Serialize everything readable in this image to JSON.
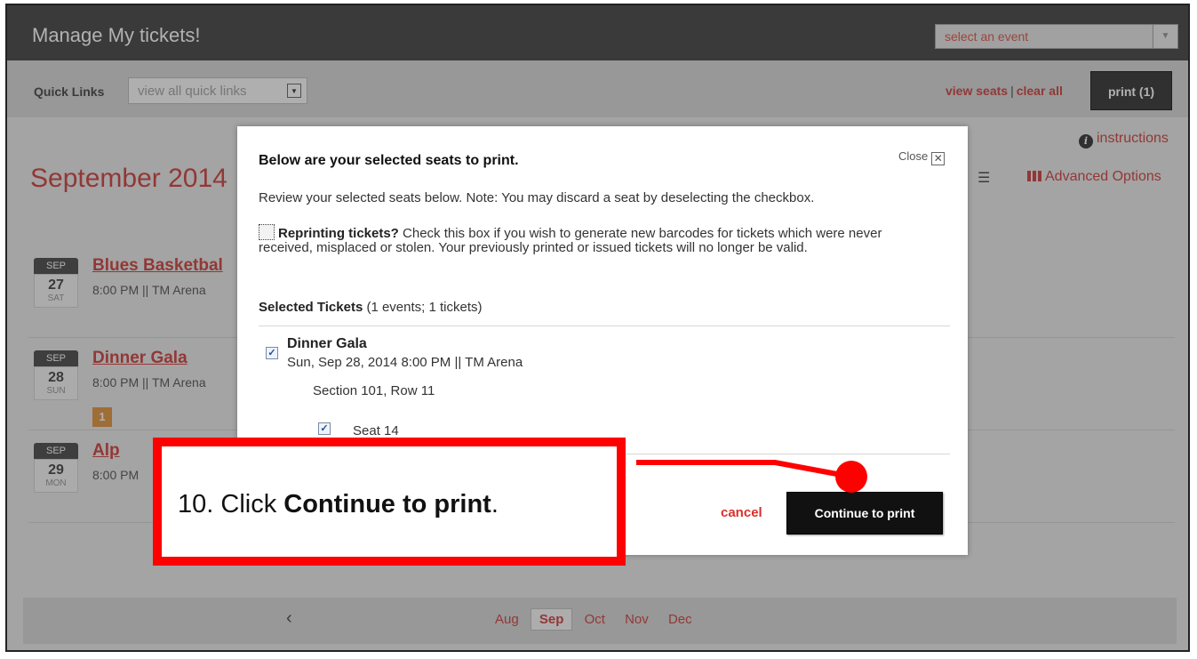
{
  "app": {
    "title": "Manage My tickets!",
    "event_select": {
      "value": "select an event"
    }
  },
  "quicklinks": {
    "label": "Quick Links",
    "select_value": "view all quick links"
  },
  "top_actions": {
    "view_seats": "view seats",
    "separator": "|",
    "clear_all": "clear all",
    "print_button": "print (1)"
  },
  "toolbar": {
    "instructions": "instructions",
    "advanced_options": "Advanced Options"
  },
  "calendar": {
    "month_title": "September 2014",
    "events": [
      {
        "month": "SEP",
        "day": "27",
        "weekday": "SAT",
        "name": "Blues Basketbal",
        "meta": "8:00 PM || TM Arena",
        "badge": ""
      },
      {
        "month": "SEP",
        "day": "28",
        "weekday": "SUN",
        "name": "Dinner Gala",
        "meta": "8:00 PM || TM Arena",
        "badge": "1"
      },
      {
        "month": "SEP",
        "day": "29",
        "weekday": "MON",
        "name": "Alp",
        "meta": "8:00 PM",
        "badge": ""
      }
    ],
    "nav": {
      "prev_icon": "chevron-left",
      "months": [
        "Aug",
        "Sep",
        "Oct",
        "Nov",
        "Dec"
      ],
      "active": "Sep"
    }
  },
  "modal": {
    "title": "Below are your selected seats to print.",
    "close_label": "Close",
    "description": "Review your selected seats below. Note: You may discard a seat by deselecting the checkbox.",
    "reprint_bold": "Reprinting tickets?",
    "reprint_text": " Check this box if you wish to generate new barcodes for tickets which were never received, misplaced or stolen. Your previously printed or issued tickets will no longer be valid.",
    "reprint_checked": false,
    "selected_label": "Selected Tickets",
    "selected_counts": " (1 events; 1 tickets)",
    "ticket": {
      "event_name": "Dinner Gala",
      "date_venue": "Sun, Sep 28, 2014 8:00 PM || TM Arena",
      "section_row": "Section 101, Row 11",
      "seat": "Seat 14",
      "event_checked": true,
      "seat_checked": true
    },
    "cancel": "cancel",
    "continue": "Continue to print"
  },
  "callout": {
    "prefix": "10. Click ",
    "bold": "Continue to print",
    "suffix": ".",
    "color": "#ff0000"
  },
  "colors": {
    "accent": "#c9302c",
    "header": "#333333",
    "callout": "#ff0000"
  }
}
